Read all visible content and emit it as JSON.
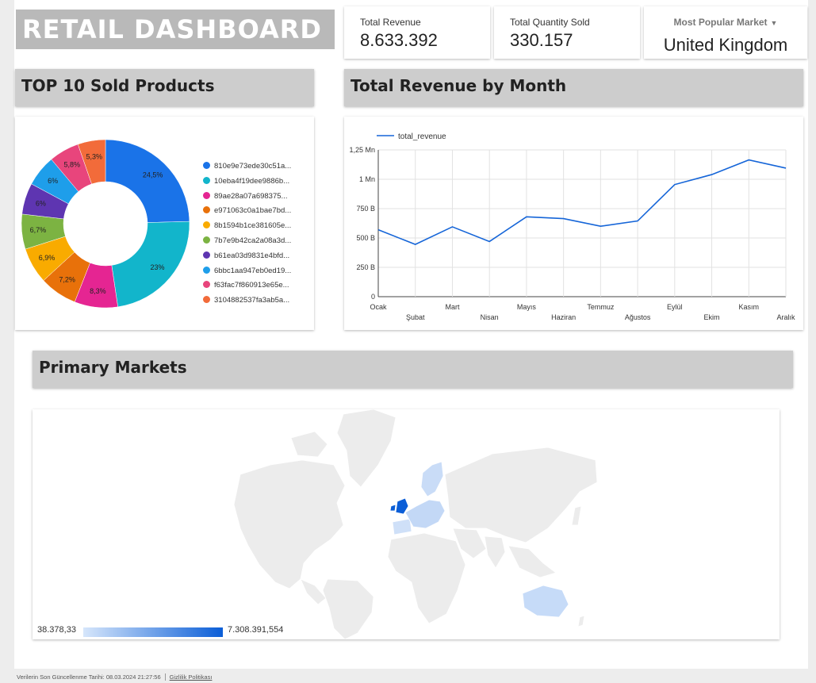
{
  "header": {
    "title": "RETAIL DASHBOARD"
  },
  "kpis": {
    "total_revenue": {
      "label": "Total Revenue",
      "value": "8.633.392"
    },
    "total_quantity": {
      "label": "Total Quantity Sold",
      "value": "330.157"
    },
    "popular_market": {
      "label": "Most Popular Market",
      "value": "United Kingdom",
      "caret_icon": "caret-down-icon"
    }
  },
  "sections": {
    "top_products": "TOP 10 Sold Products",
    "revenue_by_month": "Total Revenue by Month",
    "primary_markets": "Primary Markets"
  },
  "chart_data": [
    {
      "type": "pie",
      "variant": "donut",
      "title": "TOP 10 Sold Products",
      "labels": [
        "810e9e73ede30c51a...",
        "10eba4f19dee9886b...",
        "89ae28a07a698375...",
        "e971063c0a1bae7bd...",
        "8b1594b1ce381605e...",
        "7b7e9b42ca2a08a3d...",
        "b61ea03d9831e4bfd...",
        "6bbc1aa947eb0ed19...",
        "f63fac7f860913e65e...",
        "3104882537fa3ab5a..."
      ],
      "values": [
        24.5,
        23,
        8.3,
        7.2,
        6.9,
        6.7,
        6,
        6,
        5.8,
        5.3
      ],
      "value_labels": [
        "24,5%",
        "23%",
        "8,3%",
        "7,2%",
        "6,9%",
        "6,7%",
        "6%",
        "6%",
        "5,8%",
        "5,3%"
      ],
      "colors": [
        "#1a73e8",
        "#12b5cb",
        "#e52592",
        "#e8710a",
        "#f9ab00",
        "#7cb342",
        "#5e35b1",
        "#1e9eea",
        "#e8457c",
        "#f26b3a"
      ],
      "legend": "right"
    },
    {
      "type": "line",
      "title": "Total Revenue by Month",
      "x": [
        "Ocak",
        "Şubat",
        "Mart",
        "Nisan",
        "Mayıs",
        "Haziran",
        "Temmuz",
        "Ağustos",
        "Eylül",
        "Ekim",
        "Kasım",
        "Aralık"
      ],
      "series": [
        {
          "name": "total_revenue",
          "values": [
            570000,
            445000,
            595000,
            470000,
            680000,
            665000,
            600000,
            645000,
            955000,
            1040000,
            1165000,
            1095000
          ],
          "color": "#1565d8"
        }
      ],
      "yticks": [
        "0",
        "250 B",
        "500 B",
        "750 B",
        "1 Mn",
        "1,25 Mn"
      ],
      "ylim": [
        0,
        1250000
      ],
      "grid": true,
      "legend": "top-left"
    }
  ],
  "map": {
    "title": "Primary Markets",
    "scale_min": "38.378,33",
    "scale_max": "7.308.391,554",
    "highlighted": [
      "United Kingdom",
      "Netherlands",
      "Germany",
      "France",
      "Norway",
      "Sweden",
      "Australia",
      "Portugal",
      "Spain"
    ]
  },
  "footer": {
    "updated": "Verilerin Son Güncellenme Tarihi: 08.03.2024 21:27:56",
    "privacy": "Gizlilik Politikası"
  }
}
